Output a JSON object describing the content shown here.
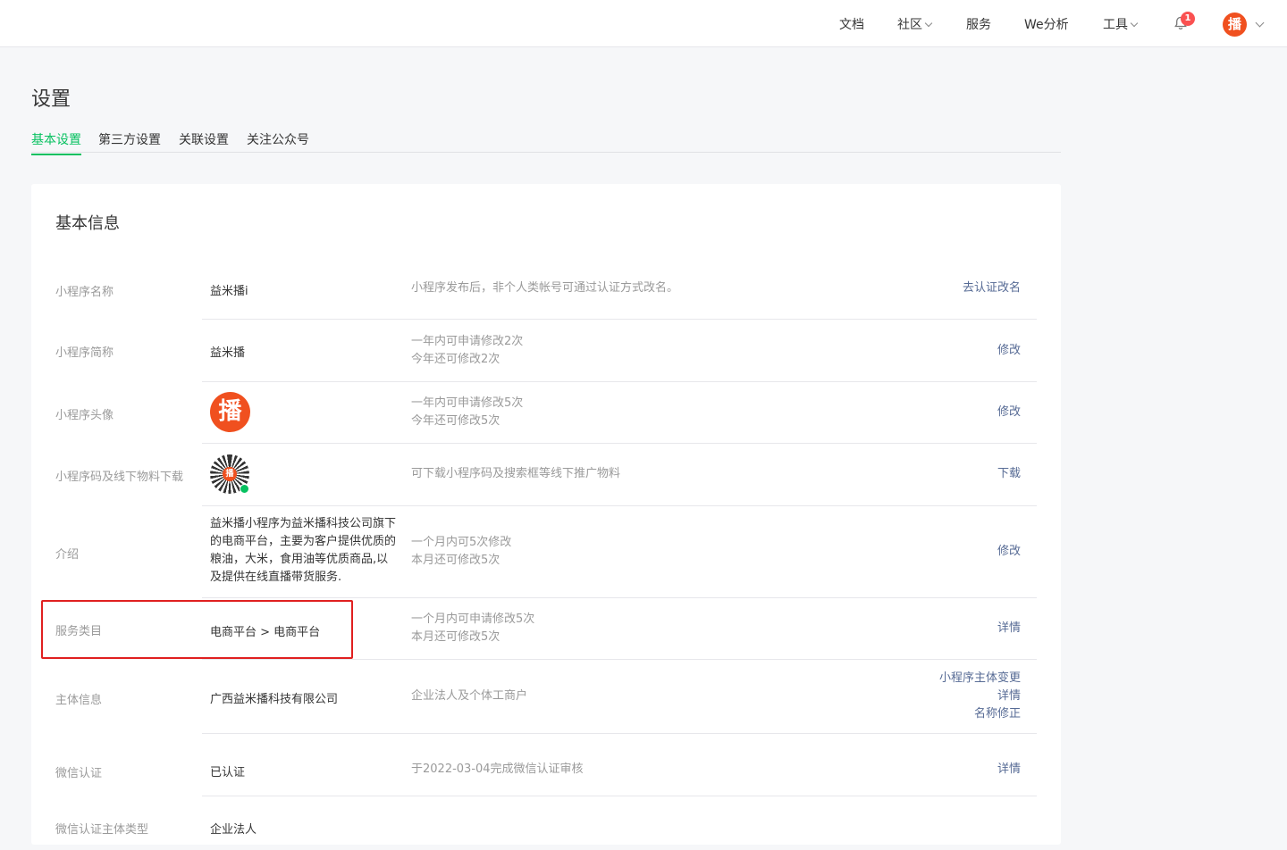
{
  "nav": {
    "items": [
      {
        "label": "文档",
        "dropdown": false
      },
      {
        "label": "社区",
        "dropdown": true
      },
      {
        "label": "服务",
        "dropdown": false
      },
      {
        "label": "We分析",
        "dropdown": false
      },
      {
        "label": "工具",
        "dropdown": true
      }
    ],
    "notification_count": "1",
    "avatar_text": "播"
  },
  "page": {
    "title": "设置",
    "tabs": [
      {
        "label": "基本设置",
        "active": true
      },
      {
        "label": "第三方设置",
        "active": false
      },
      {
        "label": "关联设置",
        "active": false
      },
      {
        "label": "关注公众号",
        "active": false
      }
    ]
  },
  "card": {
    "title": "基本信息",
    "rows": [
      {
        "label": "小程序名称",
        "value": "益米播i",
        "hint": [
          "小程序发布后，非个人类帐号可通过认证方式改名。"
        ],
        "actions": [
          "去认证改名"
        ]
      },
      {
        "label": "小程序简称",
        "value": "益米播",
        "hint": [
          "一年内可申请修改2次",
          "今年还可修改2次"
        ],
        "actions": [
          "修改"
        ]
      },
      {
        "label": "小程序头像",
        "value": "播",
        "hint": [
          "一年内可申请修改5次",
          "今年还可修改5次"
        ],
        "actions": [
          "修改"
        ]
      },
      {
        "label": "小程序码及线下物料下载",
        "value": "播",
        "hint": [
          "可下载小程序码及搜索框等线下推广物料"
        ],
        "actions": [
          "下载"
        ]
      },
      {
        "label": "介绍",
        "value": "益米播小程序为益米播科技公司旗下的电商平台，主要为客户提供优质的粮油，大米，食用油等优质商品,以及提供在线直播带货服务.",
        "hint": [
          "一个月内可5次修改",
          "本月还可修改5次"
        ],
        "actions": [
          "修改"
        ]
      },
      {
        "label": "服务类目",
        "value": "电商平台 > 电商平台",
        "hint": [
          "一个月内可申请修改5次",
          "本月还可修改5次"
        ],
        "actions": [
          "详情"
        ]
      },
      {
        "label": "主体信息",
        "value": "广西益米播科技有限公司",
        "hint": [
          "企业法人及个体工商户"
        ],
        "actions": [
          "小程序主体变更",
          "详情",
          "名称修正"
        ]
      },
      {
        "label": "微信认证",
        "value": "已认证",
        "hint": [
          "于2022-03-04完成微信认证审核"
        ],
        "actions": [
          "详情"
        ]
      },
      {
        "label": "微信认证主体类型",
        "value": "企业法人",
        "hint": [],
        "actions": []
      }
    ]
  },
  "colors": {
    "accent": "#07c160",
    "link": "#576b95",
    "highlight": "#e02020",
    "brand": "#f0501f"
  }
}
